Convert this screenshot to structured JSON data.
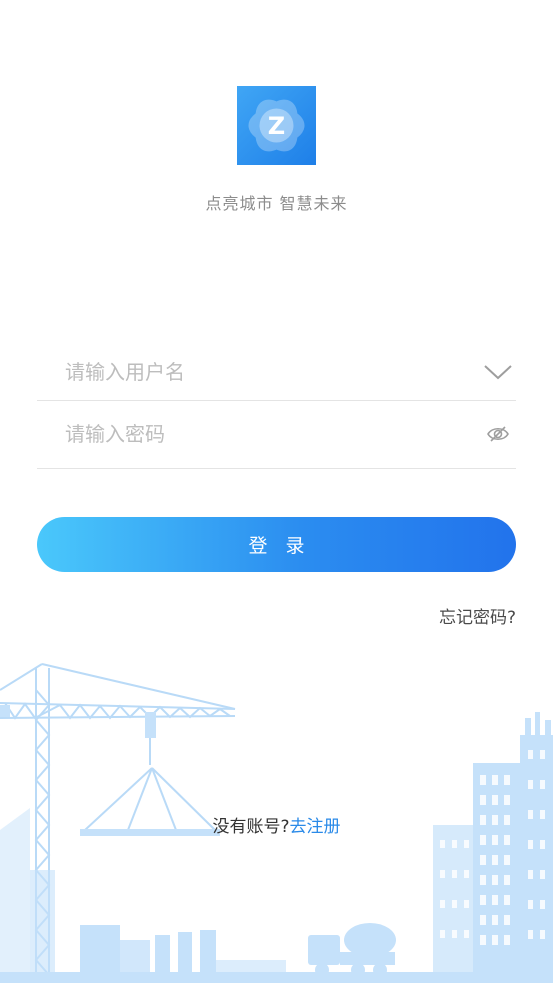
{
  "brand": {
    "logo_letter": "Z",
    "slogan": "点亮城市  智慧未来"
  },
  "form": {
    "username_placeholder": "请输入用户名",
    "password_placeholder": "请输入密码"
  },
  "actions": {
    "login_label": "登 录",
    "forgot_password": "忘记密码?",
    "no_account_prompt": "没有账号?",
    "register_link": "去注册"
  },
  "colors": {
    "accent": "#2a8ae8",
    "button_gradient_start": "#4ac8fb",
    "button_gradient_end": "#2273ec",
    "illustration": "#c5e1fa"
  },
  "icons": {
    "username_dropdown": "chevron-down-icon",
    "password_visibility": "eye-off-icon"
  }
}
